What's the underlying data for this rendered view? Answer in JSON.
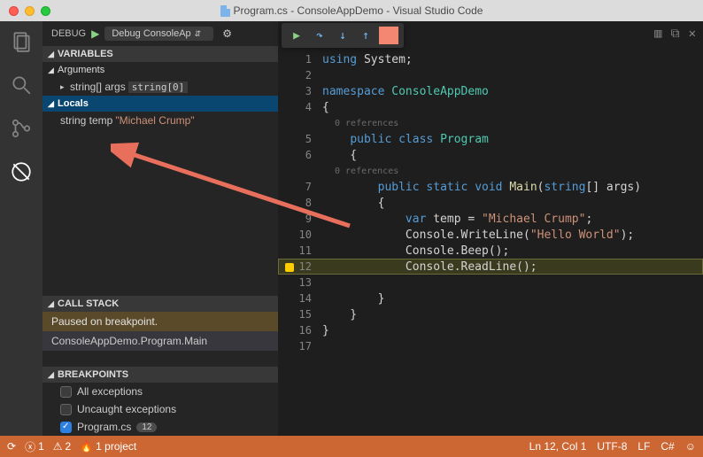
{
  "window": {
    "title": "Program.cs - ConsoleAppDemo - Visual Studio Code"
  },
  "sidebar": {
    "title": "DEBUG",
    "config": "Debug ConsoleAp",
    "sections": {
      "variables": "VARIABLES",
      "arguments": "Arguments",
      "locals": "Locals",
      "callstack": "CALL STACK",
      "breakpoints": "BREAKPOINTS"
    },
    "args_var": {
      "name": "string[] args",
      "type": "string[0]"
    },
    "locals_var": {
      "name": "string temp",
      "value": "\"Michael Crump\""
    },
    "callstack": {
      "status": "Paused on breakpoint.",
      "frame": "ConsoleAppDemo.Program.Main"
    },
    "breakpoints": {
      "all": "All exceptions",
      "uncaught": "Uncaught exceptions",
      "file": "Program.cs",
      "file_line": "12"
    }
  },
  "editor": {
    "references": "0 references",
    "lines": [
      {
        "n": 1,
        "html": "<span class='kw'>using</span> System;"
      },
      {
        "n": 2,
        "html": ""
      },
      {
        "n": 3,
        "html": "<span class='kw'>namespace</span> <span class='cls'>ConsoleAppDemo</span>"
      },
      {
        "n": 4,
        "html": "{"
      },
      {
        "n": 5,
        "html": "    <span class='kw'>public class</span> <span class='cls'>Program</span>",
        "ref": true
      },
      {
        "n": 6,
        "html": "    {"
      },
      {
        "n": 7,
        "html": "        <span class='kw'>public static void</span> <span class='fn'>Main</span>(<span class='kw'>string</span>[] args)",
        "ref": true
      },
      {
        "n": 8,
        "html": "        {"
      },
      {
        "n": 9,
        "html": "            <span class='kw'>var</span> temp = <span class='str'>\"Michael Crump\"</span>;"
      },
      {
        "n": 10,
        "html": "            Console.WriteLine(<span class='str'>\"Hello World\"</span>);"
      },
      {
        "n": 11,
        "html": "            Console.Beep();"
      },
      {
        "n": 12,
        "html": "            Console.ReadLine();",
        "current": true
      },
      {
        "n": 13,
        "html": ""
      },
      {
        "n": 14,
        "html": "        }"
      },
      {
        "n": 15,
        "html": "    }"
      },
      {
        "n": 16,
        "html": "}"
      },
      {
        "n": 17,
        "html": ""
      }
    ]
  },
  "statusbar": {
    "errors": "1",
    "warnings": "2",
    "projects": "1 project",
    "ln_col": "Ln 12, Col 1",
    "encoding": "UTF-8",
    "eol": "LF",
    "lang": "C#"
  }
}
